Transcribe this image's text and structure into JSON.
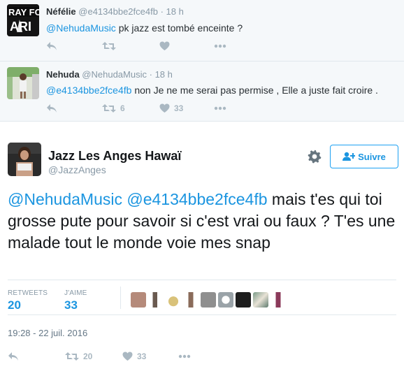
{
  "tweets": [
    {
      "name": "Néfélie",
      "handle": "@e4134bbe2fce4fb",
      "time": "18 h",
      "mention": "@NehudaMusic",
      "text": " pk jazz est tombé enceinte ?",
      "retweets": "",
      "likes": ""
    },
    {
      "name": "Nehuda",
      "handle": "@NehudaMusic",
      "time": "18 h",
      "mention": "@e4134bbe2fce4fb",
      "text": " non Je ne me serai pas permise , Elle a juste fait croire .",
      "retweets": "6",
      "likes": "33"
    }
  ],
  "main": {
    "name": "Jazz Les Anges Hawaï",
    "handle": "@JazzAnges",
    "follow_label": "Suivre",
    "mention1": "@NehudaMusic",
    "mention2": "@e4134bbe2fce4fb",
    "text": " mais t'es qui toi grosse pute pour savoir si c'est vrai ou faux ? T'es une malade tout le monde voie mes snap",
    "retweets_label": "RETWEETS",
    "retweets_count": "20",
    "likes_label": "J'AIME",
    "likes_count": "33",
    "timestamp": "19:28 - 22 juil. 2016",
    "action_retweets": "20",
    "action_likes": "33"
  },
  "colors": {
    "accent": "#1b95e0",
    "muted": "#8899a6",
    "icon": "#aab8c2"
  },
  "icons": [
    "reply-icon",
    "retweet-icon",
    "heart-icon",
    "more-icon",
    "gear-icon",
    "follow-user-icon"
  ]
}
